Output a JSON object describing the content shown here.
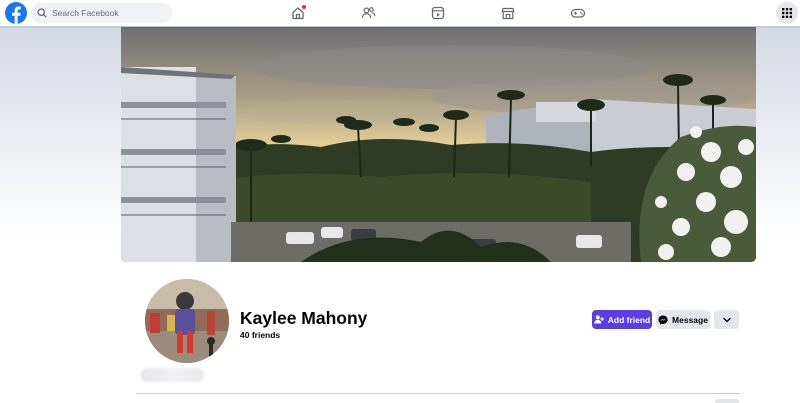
{
  "topbar": {
    "search_placeholder": "Search Facebook",
    "nav_icons": [
      "home-icon",
      "friends-icon",
      "video-icon",
      "marketplace-icon",
      "gaming-icon"
    ],
    "home_notification": true
  },
  "profile": {
    "name": "Kaylee Mahony",
    "friends_count": "40 friends",
    "add_friend_label": "Add friend",
    "message_label": "Message"
  },
  "colors": {
    "brand": "#1877f2",
    "add_friend_bg": "#5b3de6",
    "secondary_button_bg": "#e4e6eb",
    "notification_dot": "#e41e3f"
  }
}
